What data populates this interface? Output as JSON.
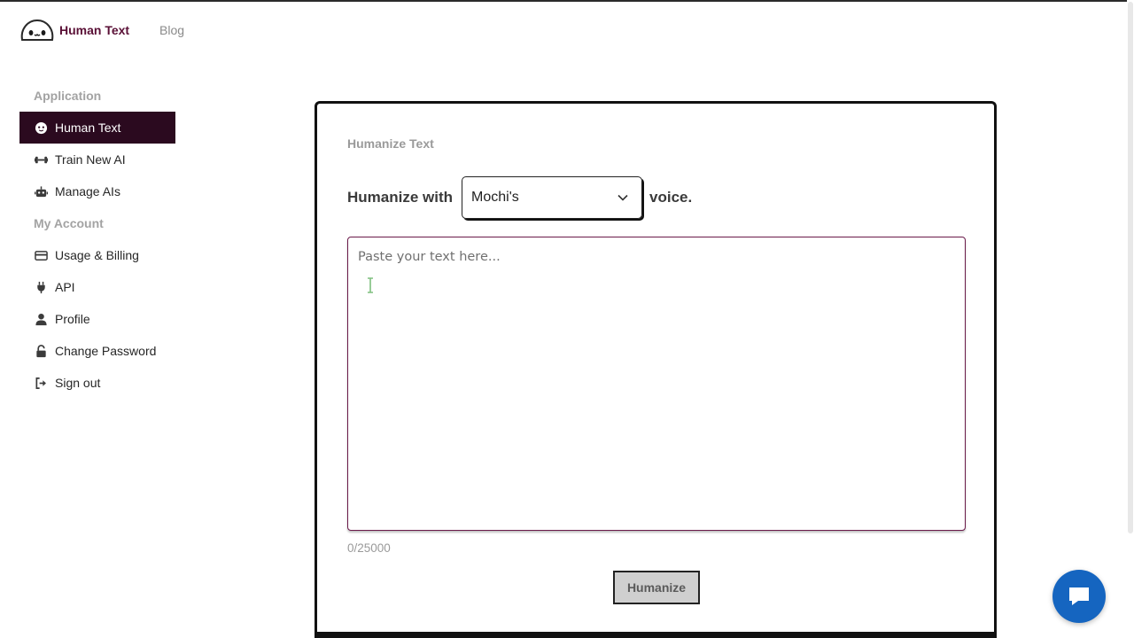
{
  "header": {
    "brand_name": "Human Text",
    "blog_label": "Blog"
  },
  "sidebar": {
    "sections": [
      {
        "label": "Application",
        "items": [
          {
            "label": "Human Text",
            "icon": "mask-icon",
            "active": true
          },
          {
            "label": "Train New AI",
            "icon": "dumbbell-icon",
            "active": false
          },
          {
            "label": "Manage AIs",
            "icon": "robot-icon",
            "active": false
          }
        ]
      },
      {
        "label": "My Account",
        "items": [
          {
            "label": "Usage & Billing",
            "icon": "credit-card-icon",
            "active": false
          },
          {
            "label": "API",
            "icon": "plug-icon",
            "active": false
          },
          {
            "label": "Profile",
            "icon": "user-icon",
            "active": false
          },
          {
            "label": "Change Password",
            "icon": "lock-icon",
            "active": false
          },
          {
            "label": "Sign out",
            "icon": "sign-out-icon",
            "active": false
          }
        ]
      }
    ]
  },
  "main": {
    "card_title": "Humanize Text",
    "humanize_prefix": "Humanize with",
    "voice_selected": "Mochi's",
    "humanize_suffix": "voice.",
    "textarea_placeholder": "Paste your text here...",
    "textarea_value": "",
    "char_counter": "0/25000",
    "submit_label": "Humanize"
  },
  "colors": {
    "brand": "#5a1036",
    "active_nav_bg": "#2b0a1f",
    "textarea_border": "#6b1a4a",
    "chat_button": "#1565c0"
  },
  "chat_widget": {
    "icon": "chat-bubble-icon"
  }
}
